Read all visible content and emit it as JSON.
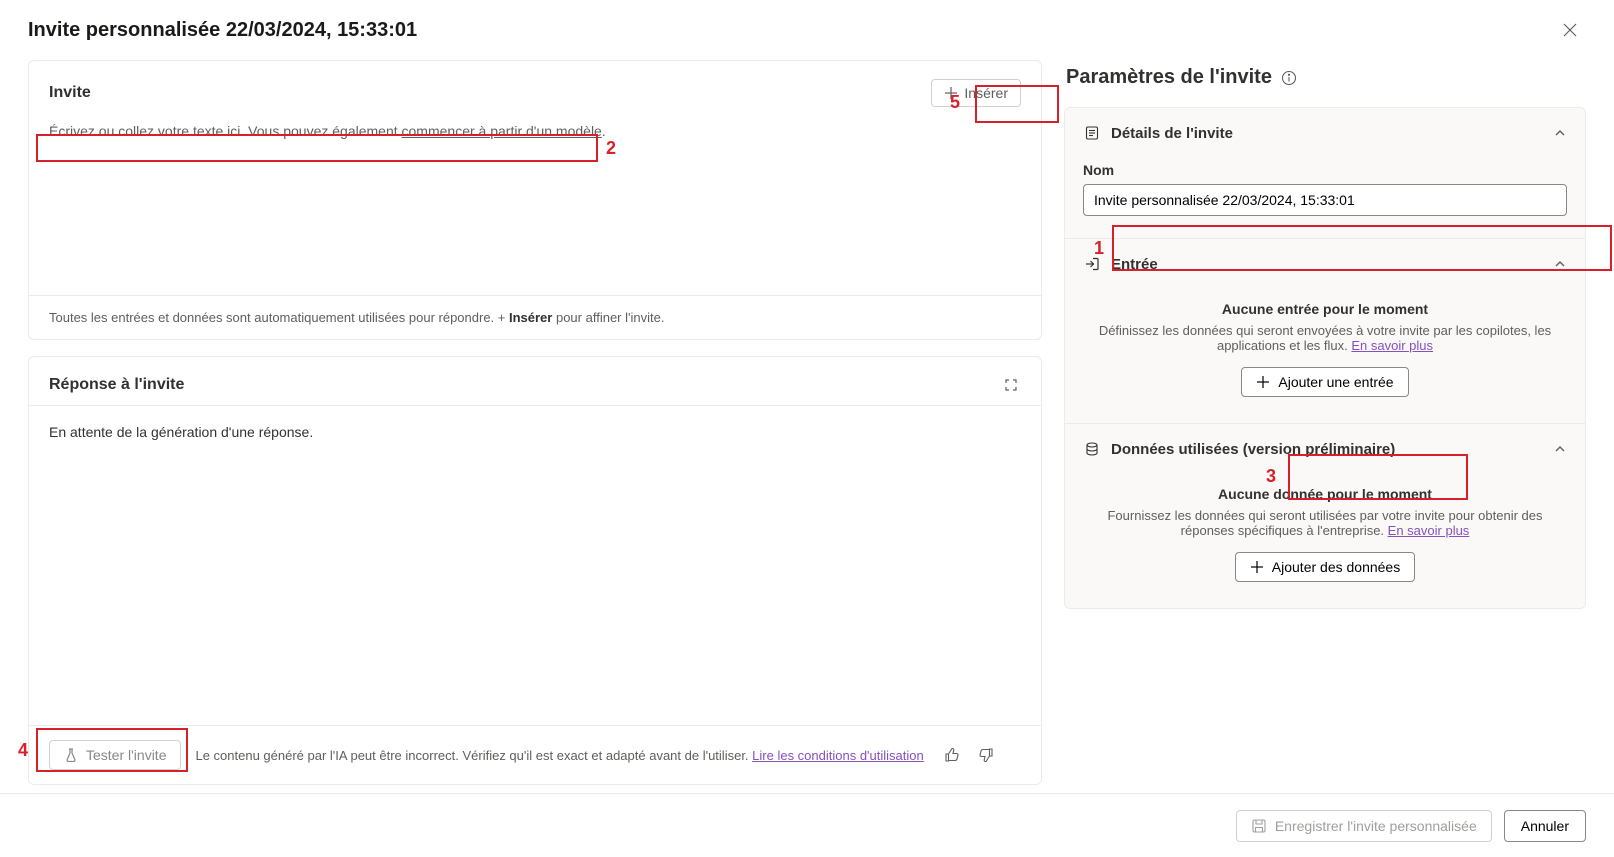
{
  "header": {
    "title": "Invite personnalisée 22/03/2024, 15:33:01"
  },
  "invite": {
    "title": "Invite",
    "insert_label": "Insérer",
    "placeholder_prefix": "Écrivez ou collez votre texte ici. Vous pouvez également ",
    "placeholder_link": "commencer à partir d'un modèle",
    "placeholder_suffix": ".",
    "hint_prefix": "Toutes les entrées et données sont automatiquement utilisées pour répondre. + ",
    "hint_bold": "Insérer",
    "hint_suffix": " pour affiner l'invite."
  },
  "response": {
    "title": "Réponse à l'invite",
    "waiting": "En attente de la génération d'une réponse.",
    "test_label": "Tester l'invite",
    "disclaimer_prefix": "Le contenu généré par l'IA peut être incorrect. Vérifiez qu'il est exact et adapté avant de l'utiliser. ",
    "terms_link": "Lire les conditions d'utilisation"
  },
  "settings": {
    "title": "Paramètres de l'invite",
    "details": {
      "header": "Détails de l'invite",
      "name_label": "Nom",
      "name_value": "Invite personnalisée 22/03/2024, 15:33:01"
    },
    "input": {
      "header": "Entrée",
      "empty_title": "Aucune entrée pour le moment",
      "empty_desc_prefix": "Définissez les données qui seront envoyées à votre invite par les copilotes, les applications et les flux. ",
      "learn_more": "En savoir plus",
      "add_label": "Ajouter une entrée"
    },
    "data": {
      "header": "Données utilisées (version préliminaire)",
      "empty_title": "Aucune donnée pour le moment",
      "empty_desc_prefix": "Fournissez les données qui seront utilisées par votre invite pour obtenir des réponses spécifiques à l'entreprise. ",
      "learn_more": "En savoir plus",
      "add_label": "Ajouter des données"
    }
  },
  "footer": {
    "save_label": "Enregistrer l'invite personnalisée",
    "cancel_label": "Annuler"
  },
  "annotations": {
    "1": "1",
    "2": "2",
    "3": "3",
    "4": "4",
    "5": "5"
  }
}
